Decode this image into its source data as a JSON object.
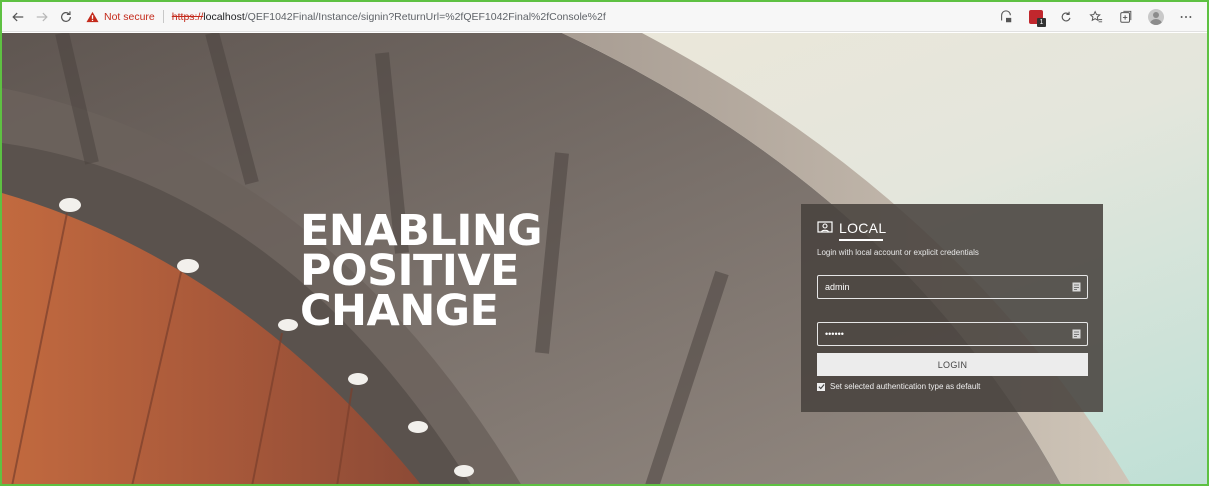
{
  "browser": {
    "security_label": "Not secure",
    "url_scheme": "https://",
    "url_host": "localhost",
    "url_path": "/QEF1042Final/Instance/signin?ReturnUrl=%2fQEF1042Final%2fConsole%2f",
    "icons": [
      "back-icon",
      "forward-icon",
      "refresh-icon",
      "warning-icon",
      "tracking-icon",
      "extension-icon",
      "sync-icon",
      "favorites-icon",
      "collections-icon",
      "profile-icon",
      "more-icon"
    ],
    "colors": {
      "warning": "#c42b1c",
      "frame_border": "#5ec142"
    }
  },
  "hero": {
    "line1": "ENABLING",
    "line2": "POSITIVE",
    "line3": "CHANGE"
  },
  "login": {
    "title": "LOCAL",
    "subtitle": "Login with local account or explicit credentials",
    "username_value": "admin",
    "password_value": "••••••",
    "button_label": "LOGIN",
    "remember_label": "Set selected authentication type as default",
    "remember_checked": true
  }
}
